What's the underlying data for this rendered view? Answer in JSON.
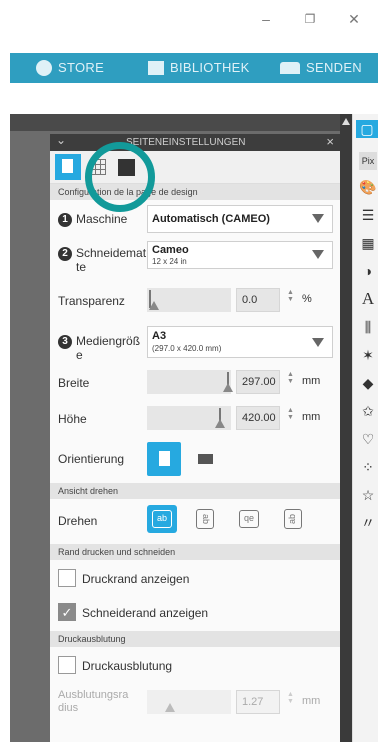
{
  "window": {
    "minimize": "–",
    "restore": "❐",
    "close": "✕"
  },
  "topbar": {
    "store": "STORE",
    "library": "BIBLIOTHEK",
    "send": "SENDEN"
  },
  "panel": {
    "title": "SEITENEINSTELLUNGEN",
    "title_visible": "SEITE  EINSTELLUNGEN",
    "collapse": "⌄",
    "close": "×",
    "section_config": "Configuration de la page de design",
    "machine": {
      "num": "1",
      "label": "Maschine",
      "value": "Automatisch (CAMEO)"
    },
    "mat": {
      "num": "2",
      "label_line1": "Schneidemat",
      "label_line2": "te",
      "value": "Cameo",
      "size": "12 x 24 in"
    },
    "transparency": {
      "label": "Transparenz",
      "value": "0.0",
      "unit": "%",
      "fraction": 0.0
    },
    "media": {
      "num": "3",
      "label_line1": "Mediengröß",
      "label_line2": "e",
      "value": "A3",
      "size": "(297.0 x 420.0 mm)"
    },
    "width": {
      "label": "Breite",
      "value": "297.00",
      "unit": "mm"
    },
    "height": {
      "label": "Höhe",
      "value": "420.00",
      "unit": "mm"
    },
    "orientation": {
      "label": "Orientierung"
    },
    "section_rotate": "Ansicht drehen",
    "rotate": {
      "label": "Drehen",
      "btn1": "ab",
      "btn2": "ab",
      "btn3": "qe",
      "btn4": "ab"
    },
    "section_print": "Rand drucken und schneiden",
    "print_border": {
      "label": "Druckrand anzeigen",
      "checked": false
    },
    "cut_border": {
      "label": "Schneiderand anzeigen",
      "checked": true,
      "check": "✓"
    },
    "section_bleed": "Druckausblutung",
    "bleed": {
      "label": "Druckausblutung",
      "checked": false
    },
    "bleed_radius": {
      "label_line1": "Ausblutungsra",
      "label_line2": "dius",
      "value": "1.27",
      "unit": "mm"
    }
  },
  "tools": [
    "page-setup-icon",
    "pixscan-icon",
    "palette-icon",
    "line-style-icon",
    "fill-icon",
    "transparency-icon",
    "text-icon",
    "align-icon",
    "replicate-icon",
    "offset-icon",
    "trace-icon",
    "library-icon",
    "sketch-icon",
    "star-icon",
    "pen-icon"
  ],
  "colors": {
    "accent": "#26a9e0",
    "topbar": "#2f9ec0",
    "highlight_ring": "#129a9a"
  }
}
